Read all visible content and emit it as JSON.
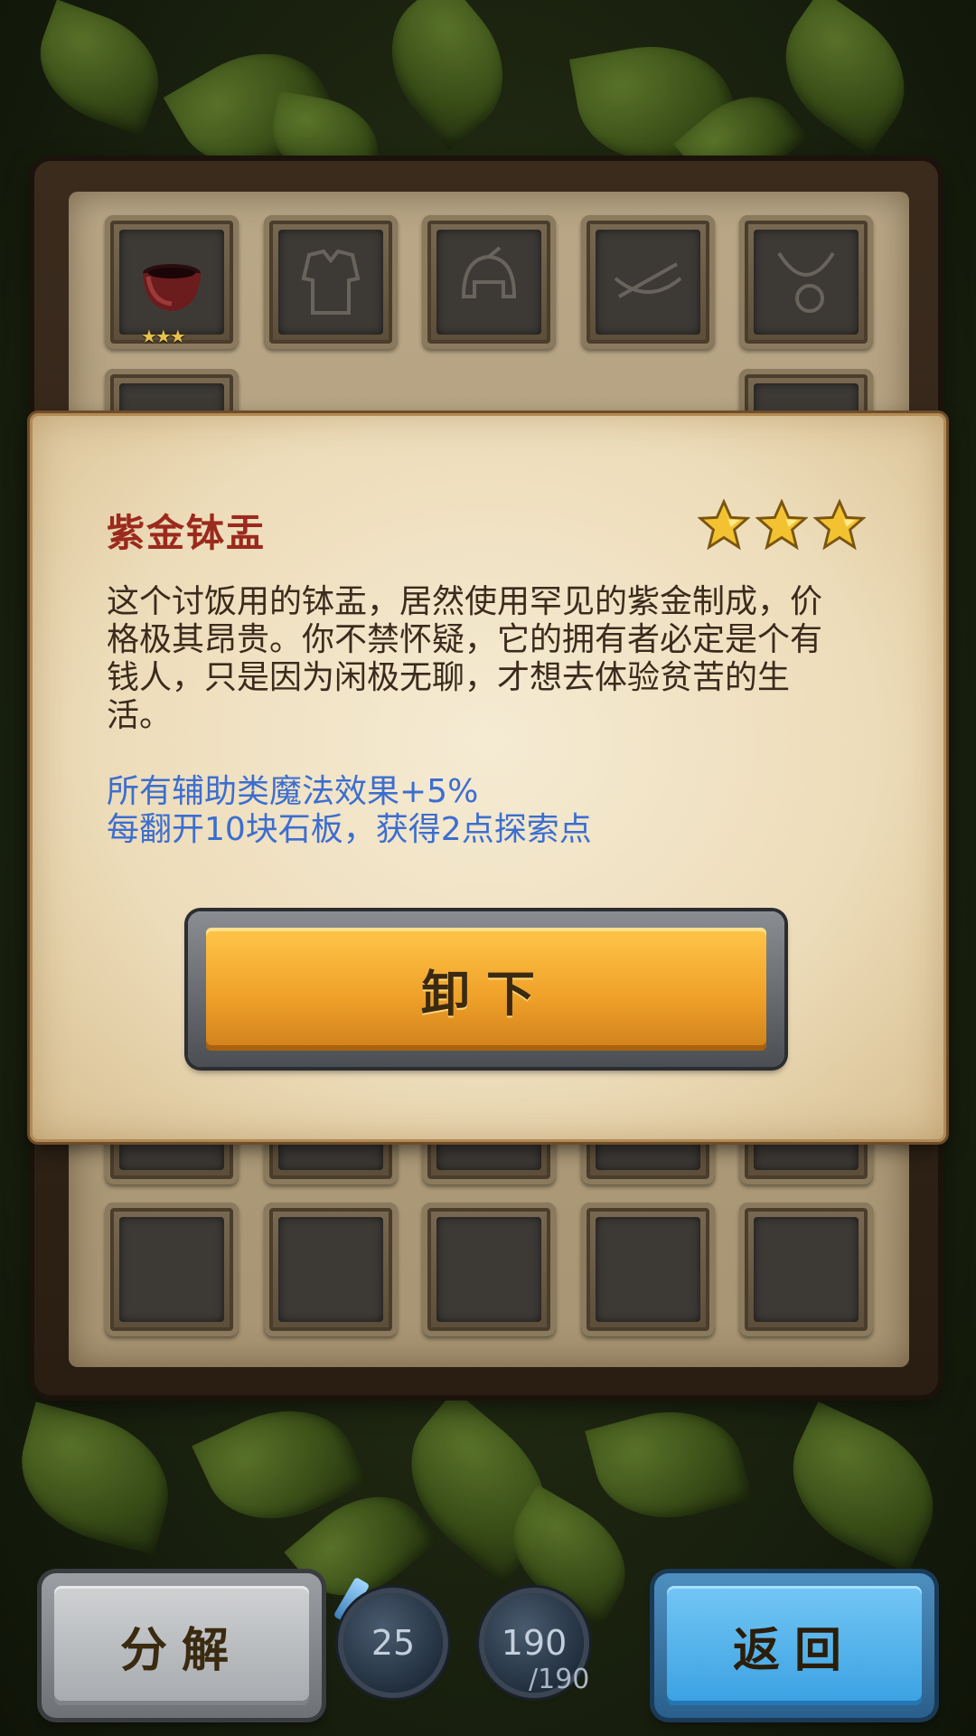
{
  "equipment_grid": {
    "slot_icons": [
      "bowl-icon",
      "armor-icon",
      "helmet-icon",
      "crossbow-icon",
      "amulet-icon",
      "ring-icon"
    ],
    "equipped_item_stars": "★★★"
  },
  "item_modal": {
    "name": "紫金钵盂",
    "star_rating": 3,
    "description": "这个讨饭用的钵盂，居然使用罕见的紫金制成，价格极其昂贵。你不禁怀疑，它的拥有者必定是个有钱人，只是因为闲极无聊，才想去体验贫苦的生活。",
    "effects": [
      "所有辅助类魔法效果+5%",
      "每翻开10块石板，获得2点探索点"
    ],
    "unequip_label": "卸下"
  },
  "bottom_bar": {
    "decompose_label": "分解",
    "back_label": "返回",
    "orb_left_value": "25",
    "orb_right_value": "190",
    "orb_right_max": "/190"
  },
  "colors": {
    "item_name": "#9b2a1e",
    "effect_text": "#3c6ed0",
    "unequip_button": "#f0a22a",
    "back_button": "#3aa1e2"
  }
}
